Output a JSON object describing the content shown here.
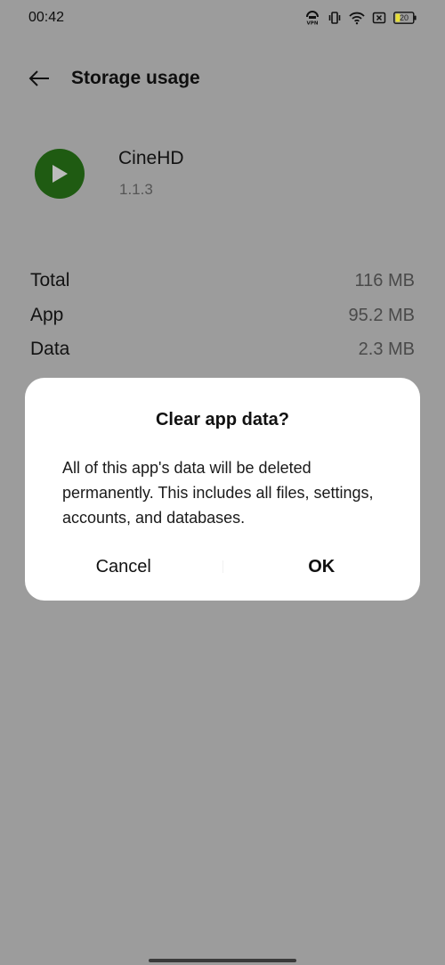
{
  "status_bar": {
    "time": "00:42",
    "battery_level": "20"
  },
  "header": {
    "title": "Storage usage"
  },
  "app": {
    "name": "CineHD",
    "version": "1.1.3",
    "icon": "play-icon",
    "icon_color": "#1f5b12"
  },
  "storage": {
    "rows": [
      {
        "label": "Total",
        "value": "116 MB"
      },
      {
        "label": "App",
        "value": "95.2 MB"
      },
      {
        "label": "Data",
        "value": "2.3 MB"
      }
    ]
  },
  "dialog": {
    "title": "Clear app data?",
    "message": "All of this app's data will be deleted permanently. This includes all files, settings, accounts, and databases.",
    "cancel_label": "Cancel",
    "ok_label": "OK"
  }
}
